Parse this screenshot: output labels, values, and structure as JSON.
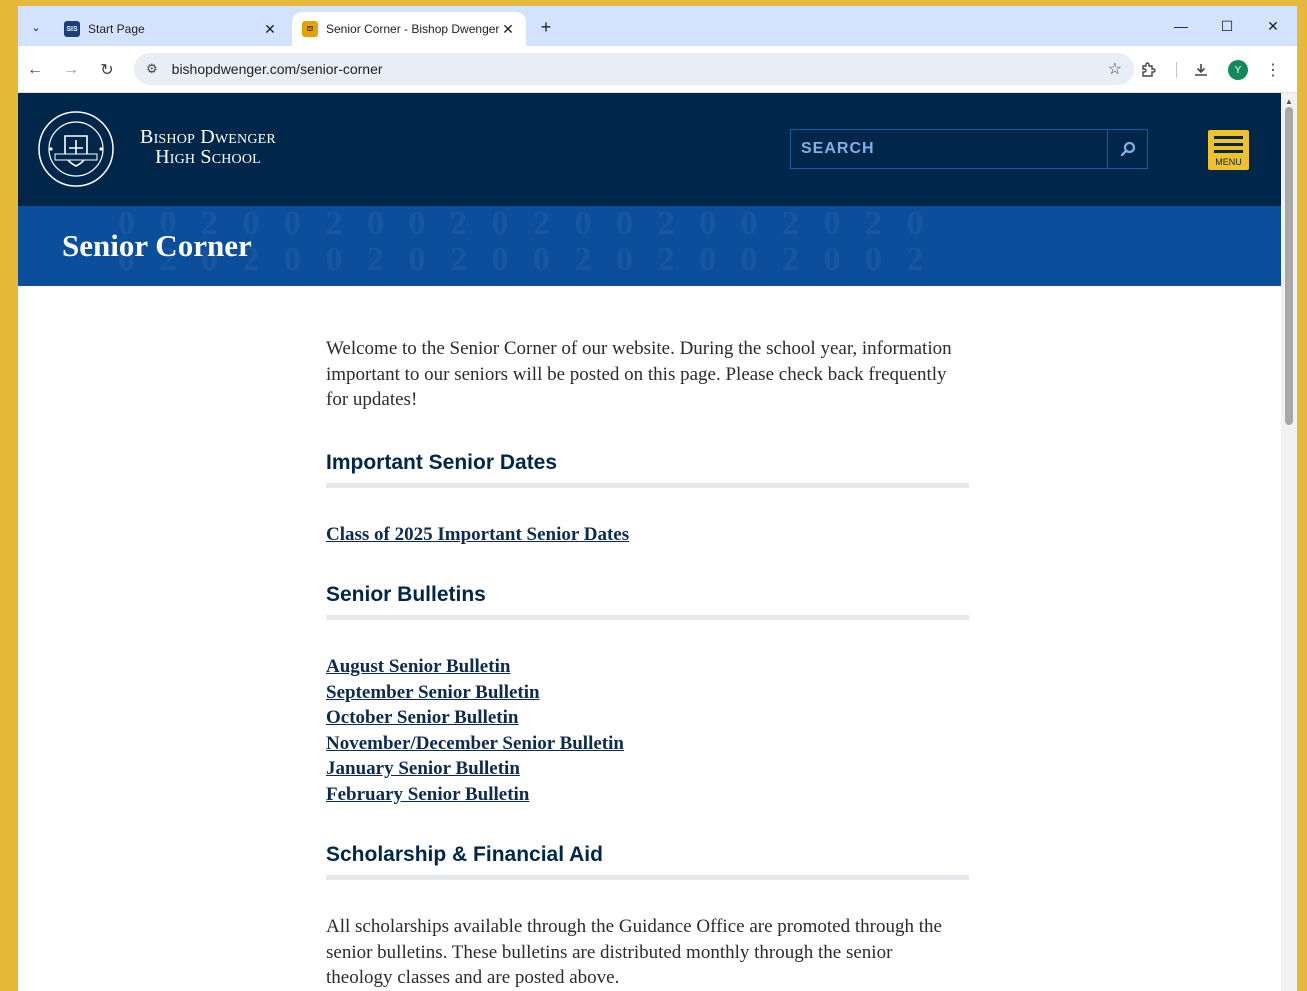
{
  "browser": {
    "tabs": [
      {
        "favicon": "SIS",
        "title": "Start Page",
        "close": "✕"
      },
      {
        "favicon": "⛫",
        "title": "Senior Corner - Bishop Dwenger",
        "close": "✕"
      }
    ],
    "new_tab": "+",
    "controls": {
      "minimize": "—",
      "maximize": "☐",
      "close": "✕"
    },
    "url": "bishopdwenger.com/senior-corner",
    "avatar": "Y"
  },
  "header": {
    "school_name_line1": "Bishop Dwenger",
    "school_name_line2": "High School",
    "search_placeholder": "SEARCH",
    "menu_label": "MENU"
  },
  "banner": {
    "title": "Senior Corner"
  },
  "content": {
    "intro": "Welcome to the Senior Corner of our website. During the school year, information important to our seniors will be posted on this page. Please check back frequently for updates!",
    "sections": [
      {
        "heading": "Important Senior Dates",
        "links": [
          "Class of 2025 Important Senior Dates"
        ]
      },
      {
        "heading": "Senior Bulletins",
        "links": [
          "August Senior Bulletin",
          "September Senior Bulletin",
          "October Senior Bulletin",
          "November/December Senior Bulletin",
          "January Senior Bulletin",
          "February Senior Bulletin"
        ]
      },
      {
        "heading": "Scholarship & Financial Aid",
        "text": "All scholarships available through the Guidance Office are promoted through the senior bulletins. These bulletins are distributed monthly through the senior theology classes and are posted above."
      }
    ]
  },
  "colors": {
    "header_bg": "#002749",
    "banner_bg": "#0b4f9c",
    "menu_bg": "#f0c12a",
    "heading_color": "#002749",
    "window_frame": "#e6b93a"
  }
}
